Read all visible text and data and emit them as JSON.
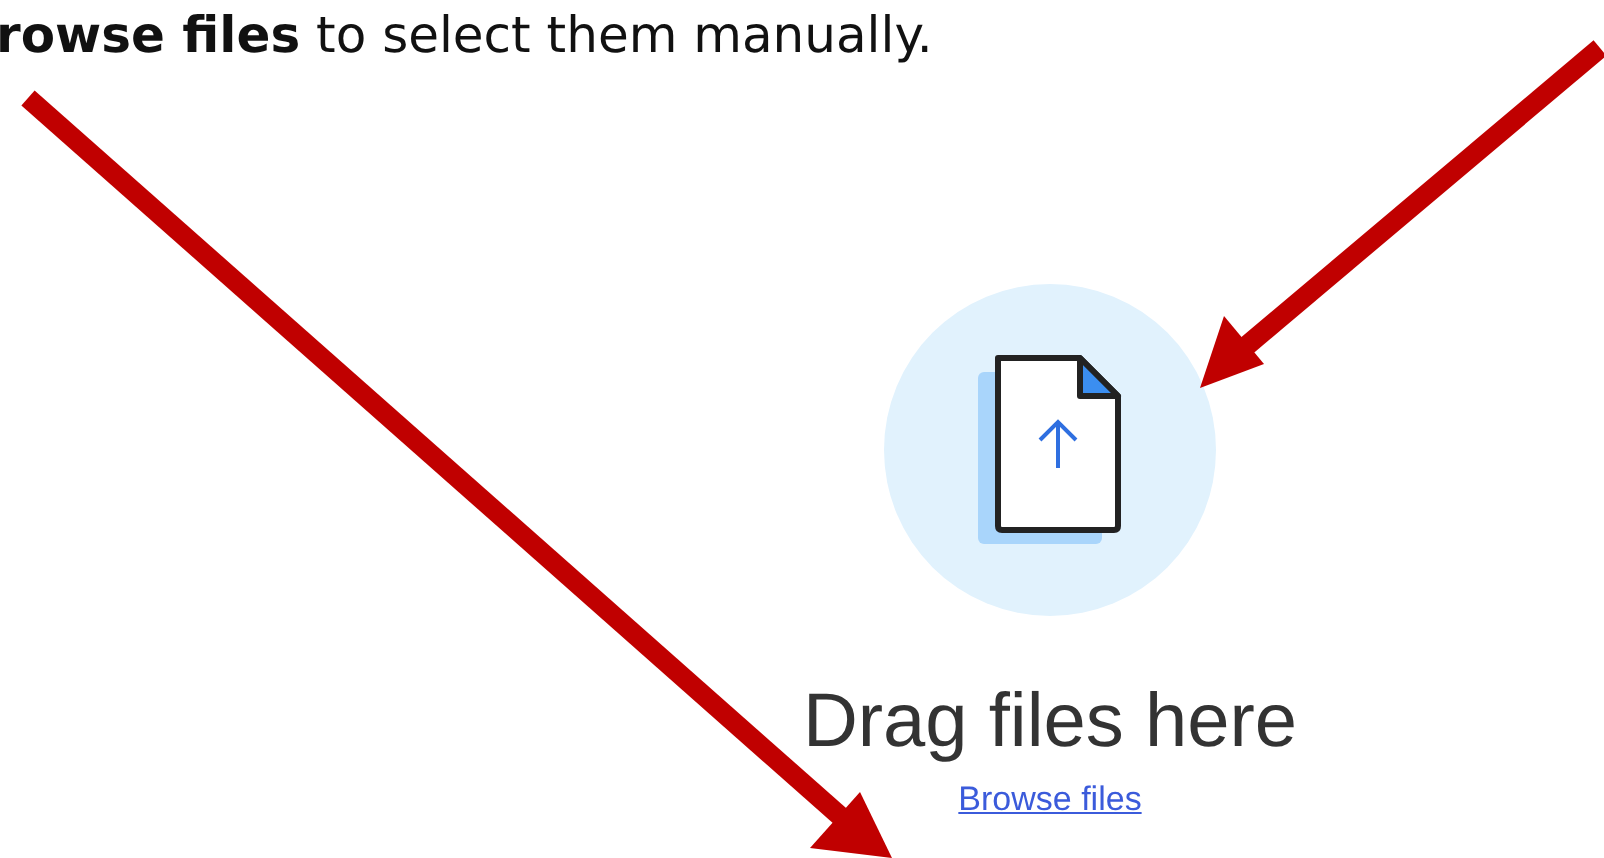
{
  "instruction": "**rowse files** to select them manually.",
  "dropzone": {
    "title": "Drag files here",
    "link": "Browse files"
  }
}
